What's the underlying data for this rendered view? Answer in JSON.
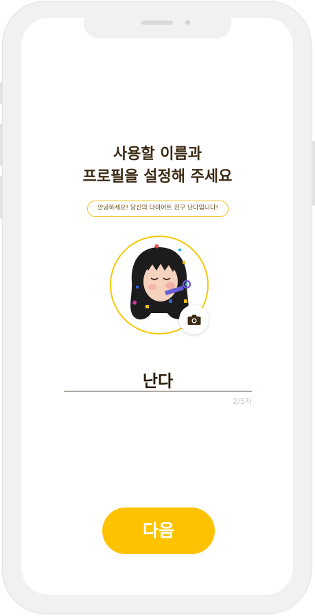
{
  "header": {
    "title_line1": "사용할 이름과",
    "title_line2": "프로필을 설정해 주세요"
  },
  "greeting": {
    "text": "안녕하세요! 당신의 다이어트 친구 난다입니다!"
  },
  "profile": {
    "avatar": "memoji-girl-party-horn",
    "camera_icon": "camera-icon",
    "ring_color": "#f7c700"
  },
  "name_field": {
    "value": "난다",
    "counter": "2/5자"
  },
  "actions": {
    "next_label": "다음"
  },
  "colors": {
    "accent": "#fdc300",
    "title_text": "#3c2a14"
  }
}
